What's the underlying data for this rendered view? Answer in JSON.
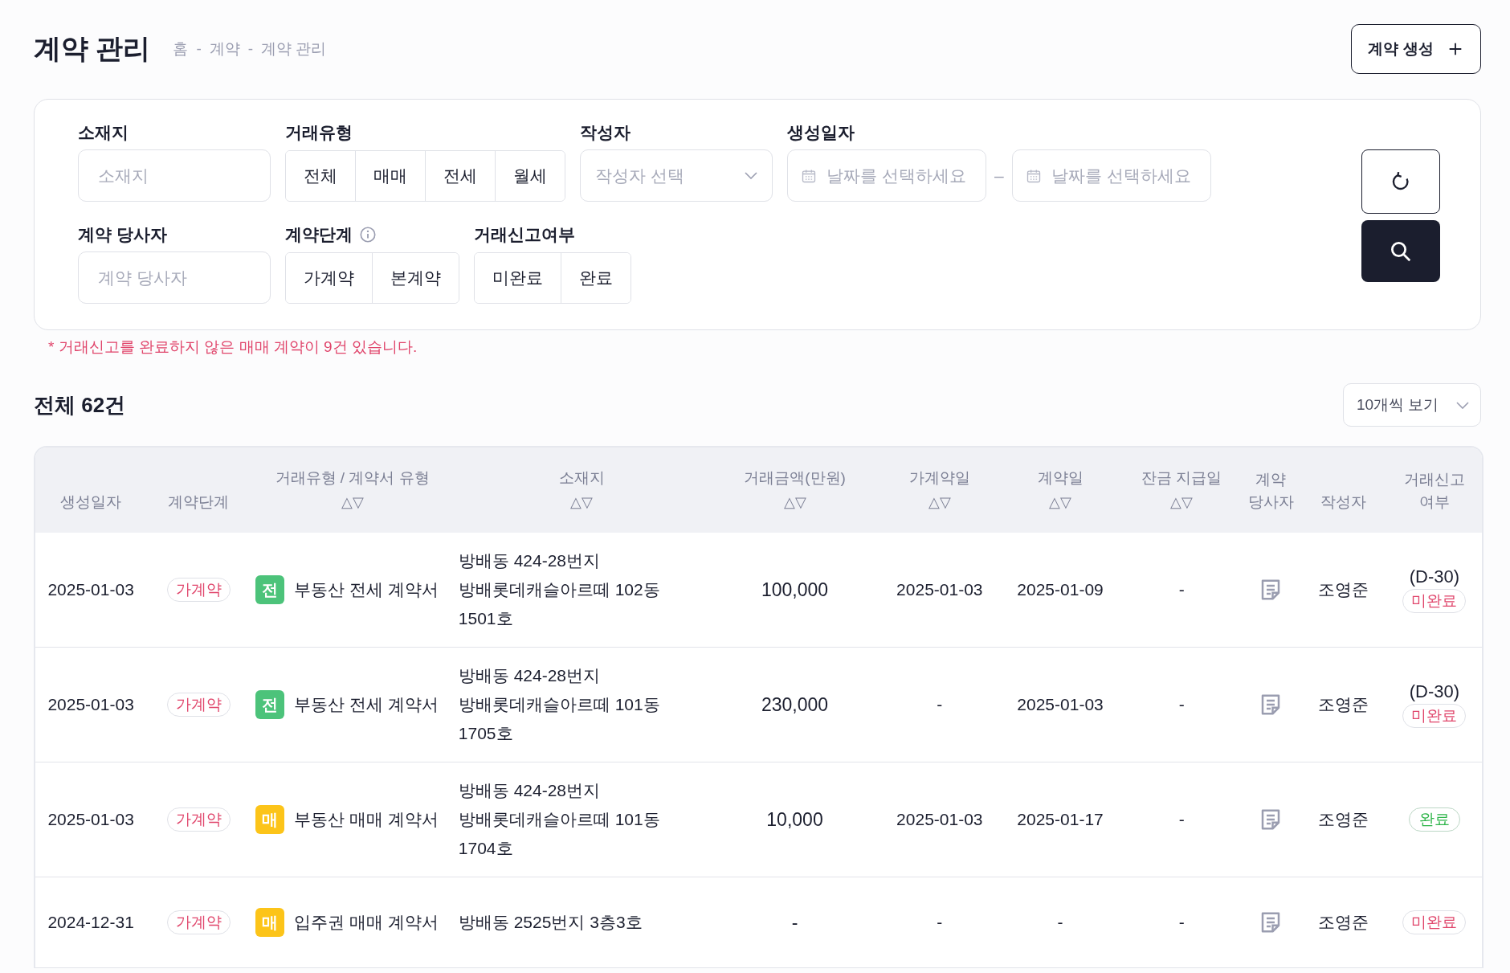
{
  "page": {
    "title": "계약 관리",
    "breadcrumb": [
      "홈",
      "계약",
      "계약 관리"
    ],
    "breadcrumb_separator": "-"
  },
  "create_button": {
    "label": "계약 생성"
  },
  "filters": {
    "location": {
      "label": "소재지",
      "placeholder": "소재지"
    },
    "trade_type": {
      "label": "거래유형",
      "options": [
        {
          "label": "전체",
          "selected": false
        },
        {
          "label": "매매",
          "selected": false
        },
        {
          "label": "전세",
          "selected": false
        },
        {
          "label": "월세",
          "selected": false
        }
      ]
    },
    "author": {
      "label": "작성자",
      "placeholder": "작성자 선택"
    },
    "created_date": {
      "label": "생성일자",
      "start": {
        "placeholder": "날짜를 선택하세요"
      },
      "separator": "–",
      "end": {
        "placeholder": "날짜를 선택하세요"
      }
    },
    "party": {
      "label": "계약 당사자",
      "placeholder": "계약 당사자"
    },
    "stage": {
      "label": "계약단계",
      "options": [
        {
          "label": "가계약",
          "selected": false
        },
        {
          "label": "본계약",
          "selected": false
        }
      ]
    },
    "report": {
      "label": "거래신고여부",
      "options": [
        {
          "label": "미완료",
          "selected": false
        },
        {
          "label": "완료",
          "selected": false
        }
      ]
    }
  },
  "notice": "* 거래신고를 완료하지 않은 매매 계약이 9건 있습니다.",
  "summary": {
    "total": "전체 62건",
    "page_size": "10개씩 보기"
  },
  "table": {
    "columns": [
      {
        "label": "생성일자"
      },
      {
        "label": "계약단계"
      },
      {
        "label": "거래유형 / 계약서 유형",
        "sort_marks": "△▽"
      },
      {
        "label": "소재지",
        "sort_marks": "△▽"
      },
      {
        "label": "거래금액(만원)",
        "sort_marks": "△▽"
      },
      {
        "label": "가계약일",
        "sort_marks": "△▽"
      },
      {
        "label": "계약일",
        "sort_marks": "△▽"
      },
      {
        "label": "잔금 지급일",
        "sort_marks": "△▽"
      },
      {
        "label": "계약 당사자"
      },
      {
        "label": "작성자"
      },
      {
        "label": "거래신고 여부"
      }
    ],
    "rows": [
      {
        "created": "2025-01-03",
        "stage": "가계약",
        "type": {
          "kind": "jeonse",
          "mark": "전",
          "label": "부동산 전세 계약서"
        },
        "location": "방배동 424-28번지 방배롯데캐슬아르떼 102동 1501호",
        "amount": "100,000",
        "provisional_date": "2025-01-03",
        "contract_date": "2025-01-09",
        "balance_date": "-",
        "author": "조영준",
        "report": {
          "deadline": "(D-30)",
          "status": "미완료",
          "done": false
        }
      },
      {
        "created": "2025-01-03",
        "stage": "가계약",
        "type": {
          "kind": "jeonse",
          "mark": "전",
          "label": "부동산 전세 계약서"
        },
        "location": "방배동 424-28번지 방배롯데캐슬아르떼 101동 1705호",
        "amount": "230,000",
        "provisional_date": "-",
        "contract_date": "2025-01-03",
        "balance_date": "-",
        "author": "조영준",
        "report": {
          "deadline": "(D-30)",
          "status": "미완료",
          "done": false
        }
      },
      {
        "created": "2025-01-03",
        "stage": "가계약",
        "type": {
          "kind": "maemae",
          "mark": "매",
          "label": "부동산 매매 계약서"
        },
        "location": "방배동 424-28번지 방배롯데캐슬아르떼 101동 1704호",
        "amount": "10,000",
        "provisional_date": "2025-01-03",
        "contract_date": "2025-01-17",
        "balance_date": "-",
        "author": "조영준",
        "report": {
          "status": "완료",
          "done": true
        }
      },
      {
        "created": "2024-12-31",
        "stage": "가계약",
        "type": {
          "kind": "maemae",
          "mark": "매",
          "label": "입주권 매매 계약서"
        },
        "location": "방배동 2525번지 3층3호",
        "amount": "-",
        "provisional_date": "-",
        "contract_date": "-",
        "balance_date": "-",
        "author": "조영준",
        "report": {
          "status": "미완료",
          "done": false
        }
      }
    ]
  }
}
